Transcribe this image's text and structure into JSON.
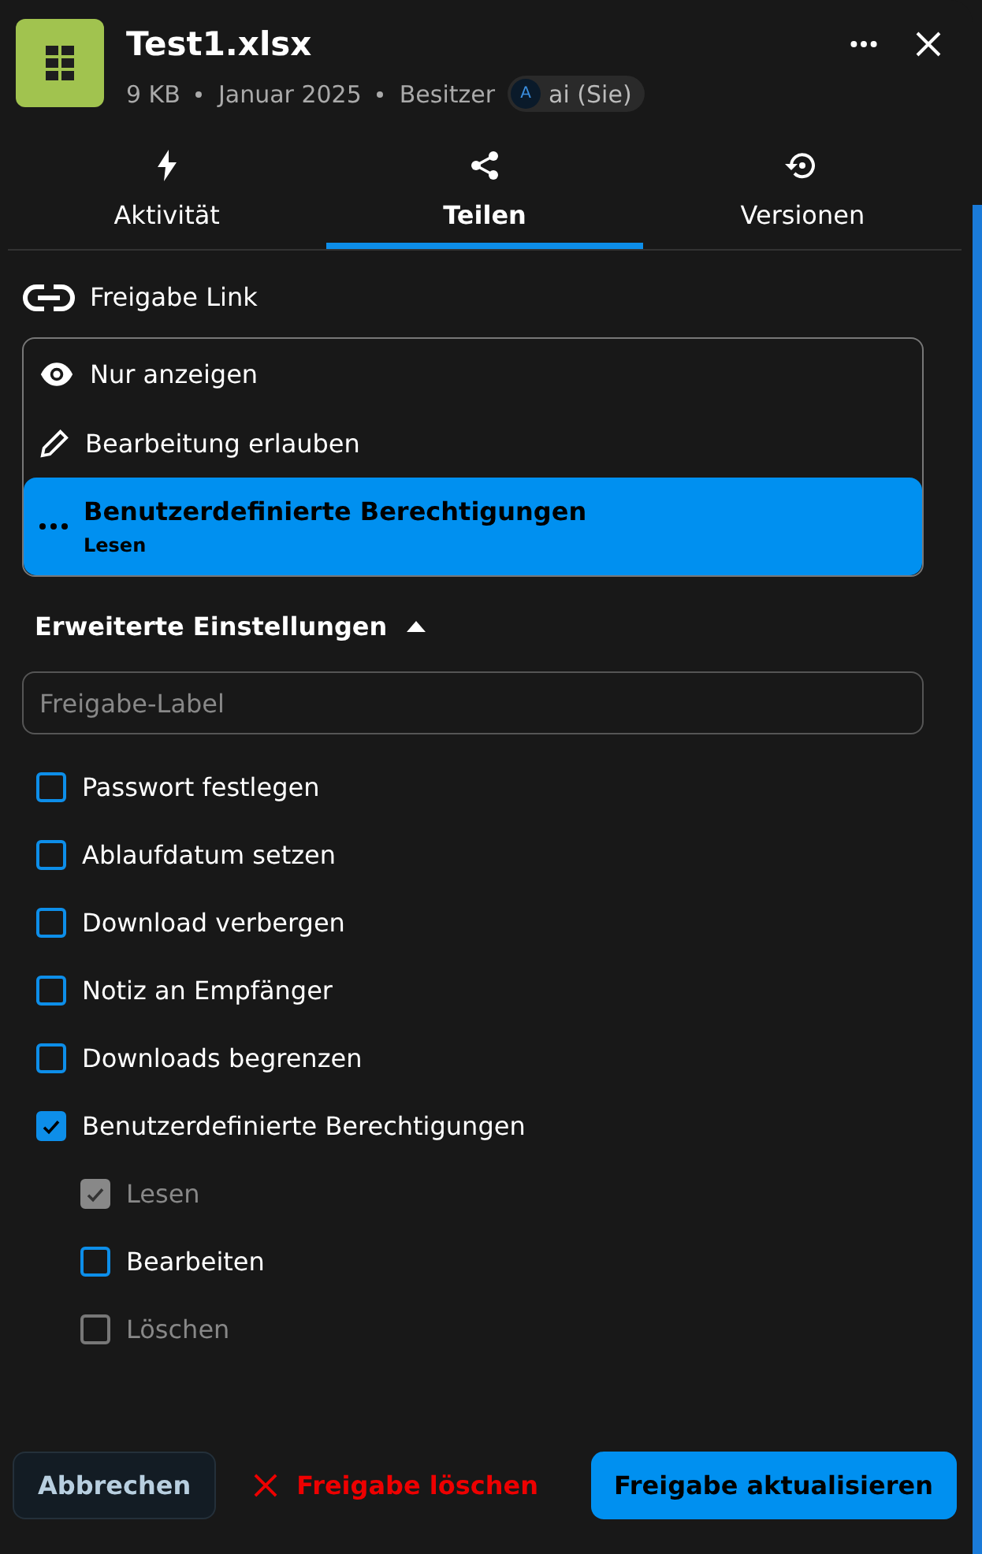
{
  "file": {
    "name": "Test1.xlsx",
    "meta": [
      "9 KB",
      "Januar 2025",
      "Besitzer"
    ],
    "owner": {
      "initial": "A",
      "name": "ai (Sie)"
    }
  },
  "tabs": [
    {
      "label": "Aktivität",
      "kind": "activity",
      "selected": false
    },
    {
      "label": "Teilen",
      "kind": "share",
      "selected": true
    },
    {
      "label": "Versionen",
      "kind": "versions",
      "selected": false
    }
  ],
  "share_link": {
    "label": "Freigabe Link"
  },
  "permission_options": [
    {
      "kind": "eye",
      "label": "Nur anzeigen",
      "selected": false
    },
    {
      "kind": "pencil",
      "label": "Bearbeitung erlauben",
      "selected": false
    },
    {
      "kind": "dots",
      "label": "Benutzerdefinierte Berechtigungen",
      "sublabel": "Lesen",
      "selected": true
    }
  ],
  "advanced": {
    "label": "Erweiterte Einstellungen",
    "expanded": true
  },
  "label_field": {
    "placeholder": "Freigabe-Label"
  },
  "settings": [
    {
      "label": "Passwort festlegen",
      "checked": false,
      "disabled": false
    },
    {
      "label": "Ablaufdatum setzen",
      "checked": false,
      "disabled": false
    },
    {
      "label": "Download verbergen",
      "checked": false,
      "disabled": false
    },
    {
      "label": "Notiz an Empfänger",
      "checked": false,
      "disabled": false
    },
    {
      "label": "Downloads begrenzen",
      "checked": false,
      "disabled": false
    },
    {
      "label": "Benutzerdefinierte Berechtigungen",
      "checked": true,
      "disabled": false,
      "children": [
        {
          "label": "Lesen",
          "checked": true,
          "disabled": true
        },
        {
          "label": "Bearbeiten",
          "checked": false,
          "disabled": false
        },
        {
          "label": "Löschen",
          "checked": false,
          "disabled": true
        }
      ]
    }
  ],
  "buttons": {
    "cancel": "Abbrechen",
    "delete": "Freigabe löschen",
    "update": "Freigabe aktualisieren"
  }
}
